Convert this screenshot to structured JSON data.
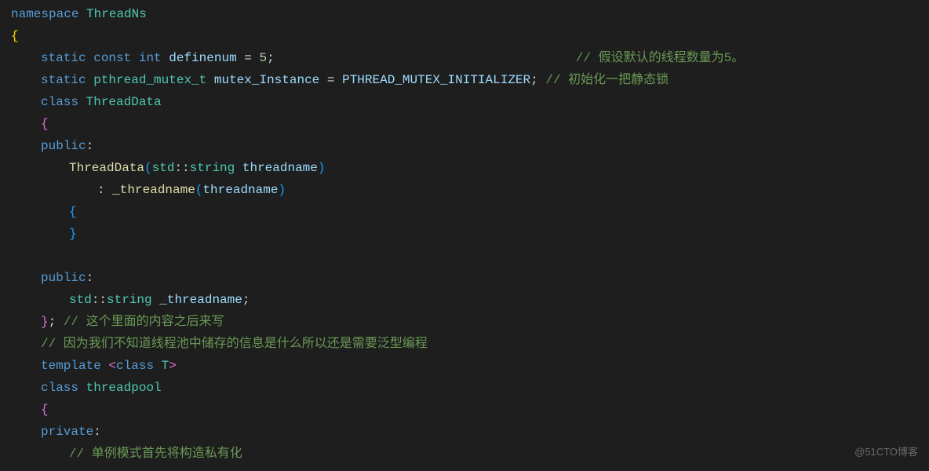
{
  "code": {
    "l1_ns": "namespace",
    "l1_name": "ThreadNs",
    "l2_brace": "{",
    "l3_static": "static",
    "l3_const": "const",
    "l3_int": "int",
    "l3_var": "definenum",
    "l3_eq": " = ",
    "l3_val": "5",
    "l3_semi": ";",
    "l3_comment": "// 假设默认的线程数量为5。",
    "l4_static": "static",
    "l4_type": "pthread_mutex_t",
    "l4_var": "mutex_Instance",
    "l4_eq": " = ",
    "l4_val": "PTHREAD_MUTEX_INITIALIZER",
    "l4_semi": ";",
    "l4_comment": "// 初始化一把静态锁",
    "l5_class": "class",
    "l5_name": "ThreadData",
    "l6_brace": "{",
    "l7_public": "public",
    "l7_colon": ":",
    "l8_ctor": "ThreadData",
    "l8_lp": "(",
    "l8_ns": "std",
    "l8_dcolon": "::",
    "l8_type": "string",
    "l8_param": "threadname",
    "l8_rp": ")",
    "l9_colon": ": ",
    "l9_member": "_threadname",
    "l9_lp": "(",
    "l9_arg": "threadname",
    "l9_rp": ")",
    "l10_brace": "{",
    "l11_brace": "}",
    "l13_public": "public",
    "l13_colon": ":",
    "l14_ns": "std",
    "l14_dcolon": "::",
    "l14_type": "string",
    "l14_var": "_threadname",
    "l14_semi": ";",
    "l15_brace": "}",
    "l15_semi": ";",
    "l15_comment": "// 这个里面的内容之后来写",
    "l16_comment": "// 因为我们不知道线程池中储存的信息是什么所以还是需要泛型编程",
    "l17_template": "template",
    "l17_lt": "<",
    "l17_class": "class",
    "l17_t": "T",
    "l17_gt": ">",
    "l18_class": "class",
    "l18_name": "threadpool",
    "l19_brace": "{",
    "l20_private": "private",
    "l20_colon": ":",
    "l21_comment": "// 单例模式首先将构造私有化"
  },
  "watermark": "@51CTO博客"
}
